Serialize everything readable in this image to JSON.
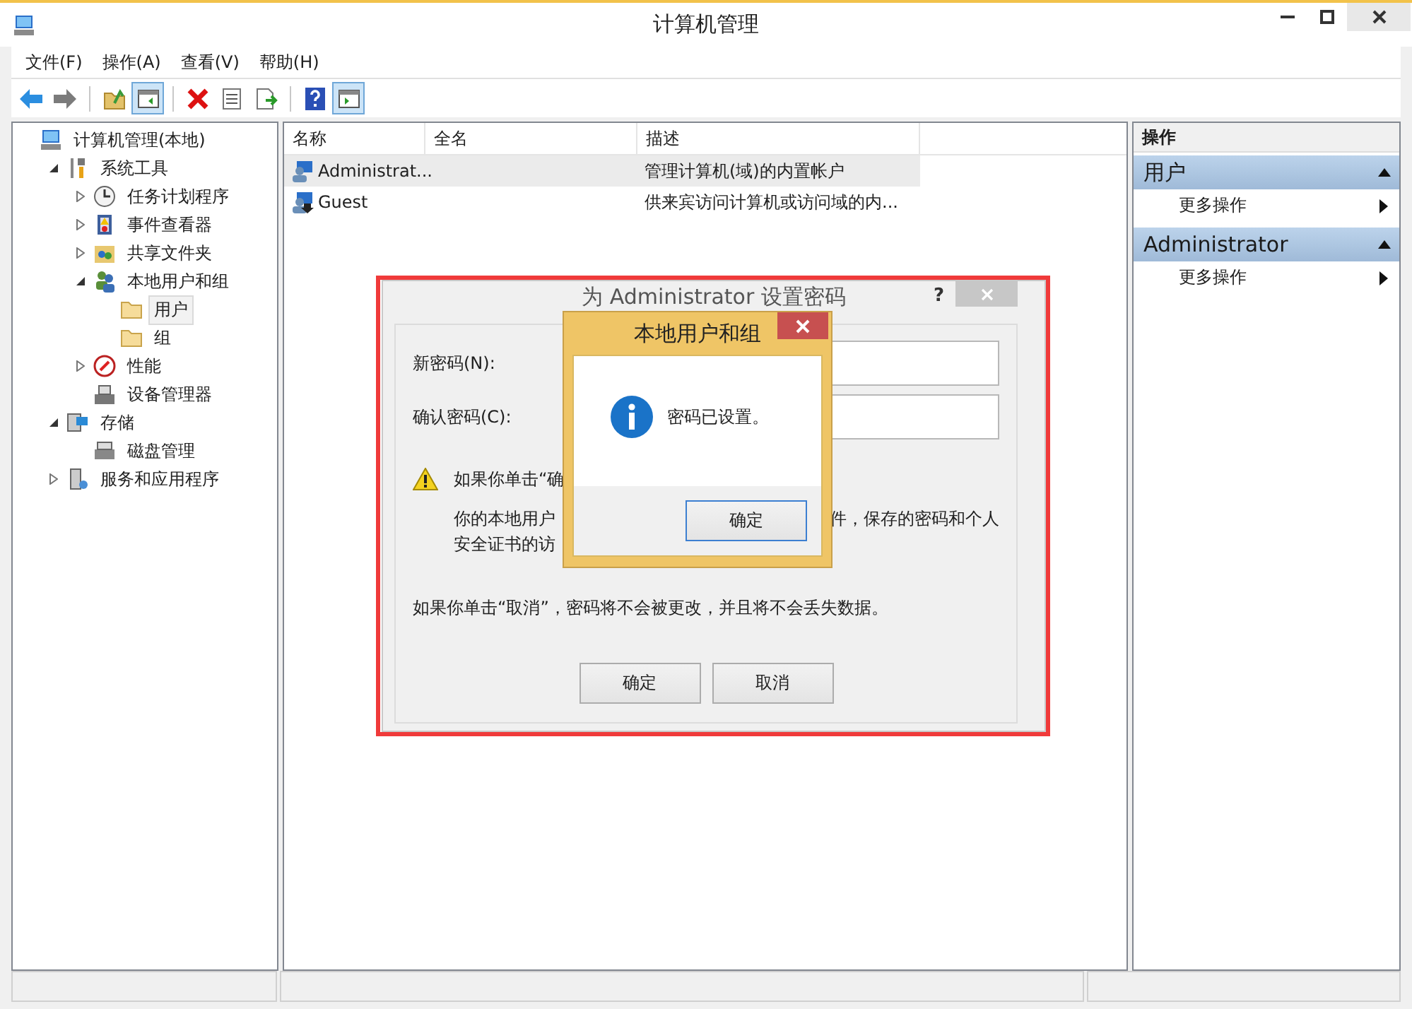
{
  "window": {
    "title": "计算机管理"
  },
  "menu": [
    {
      "label": "文件(F)"
    },
    {
      "label": "操作(A)"
    },
    {
      "label": "查看(V)"
    },
    {
      "label": "帮助(H)"
    }
  ],
  "toolbar": [
    {
      "kind": "back",
      "on": false
    },
    {
      "kind": "forward",
      "on": false
    },
    {
      "kind": "separator"
    },
    {
      "kind": "up",
      "on": false
    },
    {
      "kind": "tree",
      "on": true
    },
    {
      "kind": "separator"
    },
    {
      "kind": "delete",
      "on": false
    },
    {
      "kind": "properties",
      "on": false
    },
    {
      "kind": "export",
      "on": false
    },
    {
      "kind": "separator"
    },
    {
      "kind": "help",
      "on": false
    },
    {
      "kind": "actions",
      "on": true
    }
  ],
  "tree": [
    {
      "label": "计算机管理(本地)",
      "kind": "computer",
      "selected": false,
      "children": [
        {
          "label": "系统工具",
          "kind": "tools",
          "selected": false,
          "expanded": true,
          "children": [
            {
              "label": "任务计划程序",
              "kind": "clock",
              "selected": false,
              "expanded": false
            },
            {
              "label": "事件查看器",
              "kind": "event",
              "selected": false,
              "expanded": false
            },
            {
              "label": "共享文件夹",
              "kind": "share",
              "selected": false,
              "expanded": false
            },
            {
              "label": "本地用户和组",
              "kind": "users",
              "selected": false,
              "expanded": true,
              "children": [
                {
                  "label": "用户",
                  "kind": "folder",
                  "selected": true
                },
                {
                  "label": "组",
                  "kind": "folder",
                  "selected": false
                }
              ]
            },
            {
              "label": "性能",
              "kind": "perf",
              "selected": false,
              "expanded": false
            },
            {
              "label": "设备管理器",
              "kind": "device",
              "selected": false
            }
          ]
        },
        {
          "label": "存储",
          "kind": "storage",
          "selected": false,
          "expanded": true,
          "children": [
            {
              "label": "磁盘管理",
              "kind": "disk",
              "selected": false
            }
          ]
        },
        {
          "label": "服务和应用程序",
          "kind": "services",
          "selected": false,
          "expanded": false
        }
      ]
    }
  ],
  "list": {
    "columns": [
      "名称",
      "全名",
      "描述"
    ],
    "rows": [
      {
        "kind": "admin",
        "name": "Administrat...",
        "description": "管理计算机(域)的内置帐户",
        "selected": true
      },
      {
        "kind": "guest",
        "name": "Guest",
        "description": "供来宾访问计算机或访问域的内...",
        "selected": false
      }
    ]
  },
  "actions": {
    "title": "操作",
    "sections": [
      {
        "title": "用户",
        "expanded": true,
        "items": [
          "更多操作"
        ]
      },
      {
        "title": "Administrator",
        "expanded": true,
        "items": [
          "更多操作"
        ]
      }
    ]
  },
  "dialog": {
    "title": "为 Administrator 设置密码",
    "help": "?",
    "fields": [
      {
        "label": "新密码(N):"
      },
      {
        "label": "确认密码(C):"
      }
    ],
    "warning": "如果你单击“确",
    "detail_lines": [
      [
        "你的本地用户",
        "件，保存的密码和个人"
      ],
      [
        "安全证书的访"
      ]
    ],
    "note": "如果你单击“取消”，密码将不会被更改，并且将不会丢失数据。",
    "buttons": [
      "确定",
      "取消"
    ]
  },
  "message_box": {
    "title": "本地用户和组",
    "message": "密码已设置。",
    "button": "确定"
  }
}
